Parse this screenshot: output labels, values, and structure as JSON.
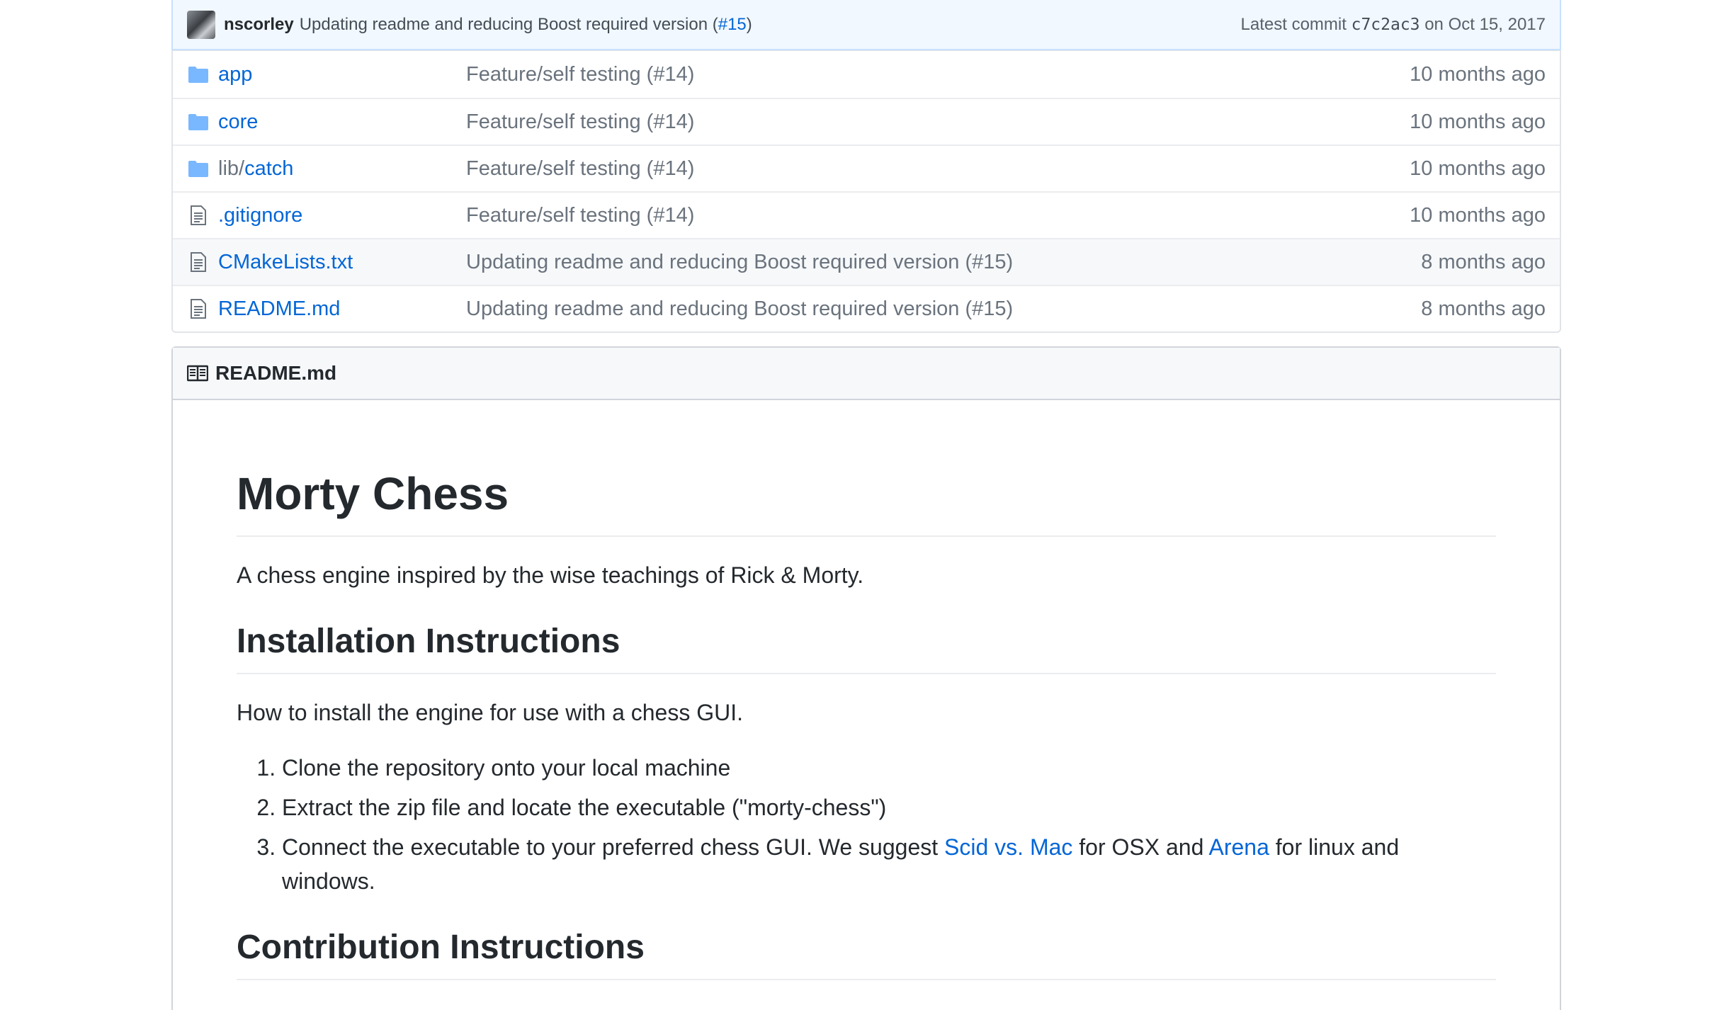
{
  "commit": {
    "author": "nscorley",
    "message": "Updating readme and reducing Boost required version (",
    "pr_link": "#15",
    "message_end": ")",
    "latest_label": "Latest commit",
    "sha": "c7c2ac3",
    "date": "on Oct 15, 2017"
  },
  "files": [
    {
      "type": "folder",
      "prefix": "",
      "name": "app",
      "message": "Feature/self testing (#14)",
      "age": "10 months ago"
    },
    {
      "type": "folder",
      "prefix": "",
      "name": "core",
      "message": "Feature/self testing (#14)",
      "age": "10 months ago"
    },
    {
      "type": "folder",
      "prefix": "lib/",
      "name": "catch",
      "message": "Feature/self testing (#14)",
      "age": "10 months ago"
    },
    {
      "type": "file",
      "prefix": "",
      "name": ".gitignore",
      "message": "Feature/self testing (#14)",
      "age": "10 months ago"
    },
    {
      "type": "file",
      "prefix": "",
      "name": "CMakeLists.txt",
      "message": "Updating readme and reducing Boost required version (#15)",
      "age": "8 months ago"
    },
    {
      "type": "file",
      "prefix": "",
      "name": "README.md",
      "message": "Updating readme and reducing Boost required version (#15)",
      "age": "8 months ago"
    }
  ],
  "readme": {
    "header": "README.md",
    "title": "Morty Chess",
    "intro": "A chess engine inspired by the wise teachings of Rick & Morty.",
    "install_heading": "Installation Instructions",
    "install_intro": "How to install the engine for use with a chess GUI.",
    "steps": {
      "s1": "Clone the repository onto your local machine",
      "s2": "Extract the zip file and locate the executable (\"morty-chess\")",
      "s3_a": "Connect the executable to your preferred chess GUI. We suggest ",
      "s3_link1": "Scid vs. Mac",
      "s3_b": " for OSX and ",
      "s3_link2": "Arena",
      "s3_c": " for linux and windows."
    },
    "contrib_heading": "Contribution Instructions"
  },
  "colors": {
    "link": "#0366d6",
    "muted": "#6a737d",
    "commit_bg": "#f1f8ff",
    "folder_icon": "#79b8ff"
  }
}
